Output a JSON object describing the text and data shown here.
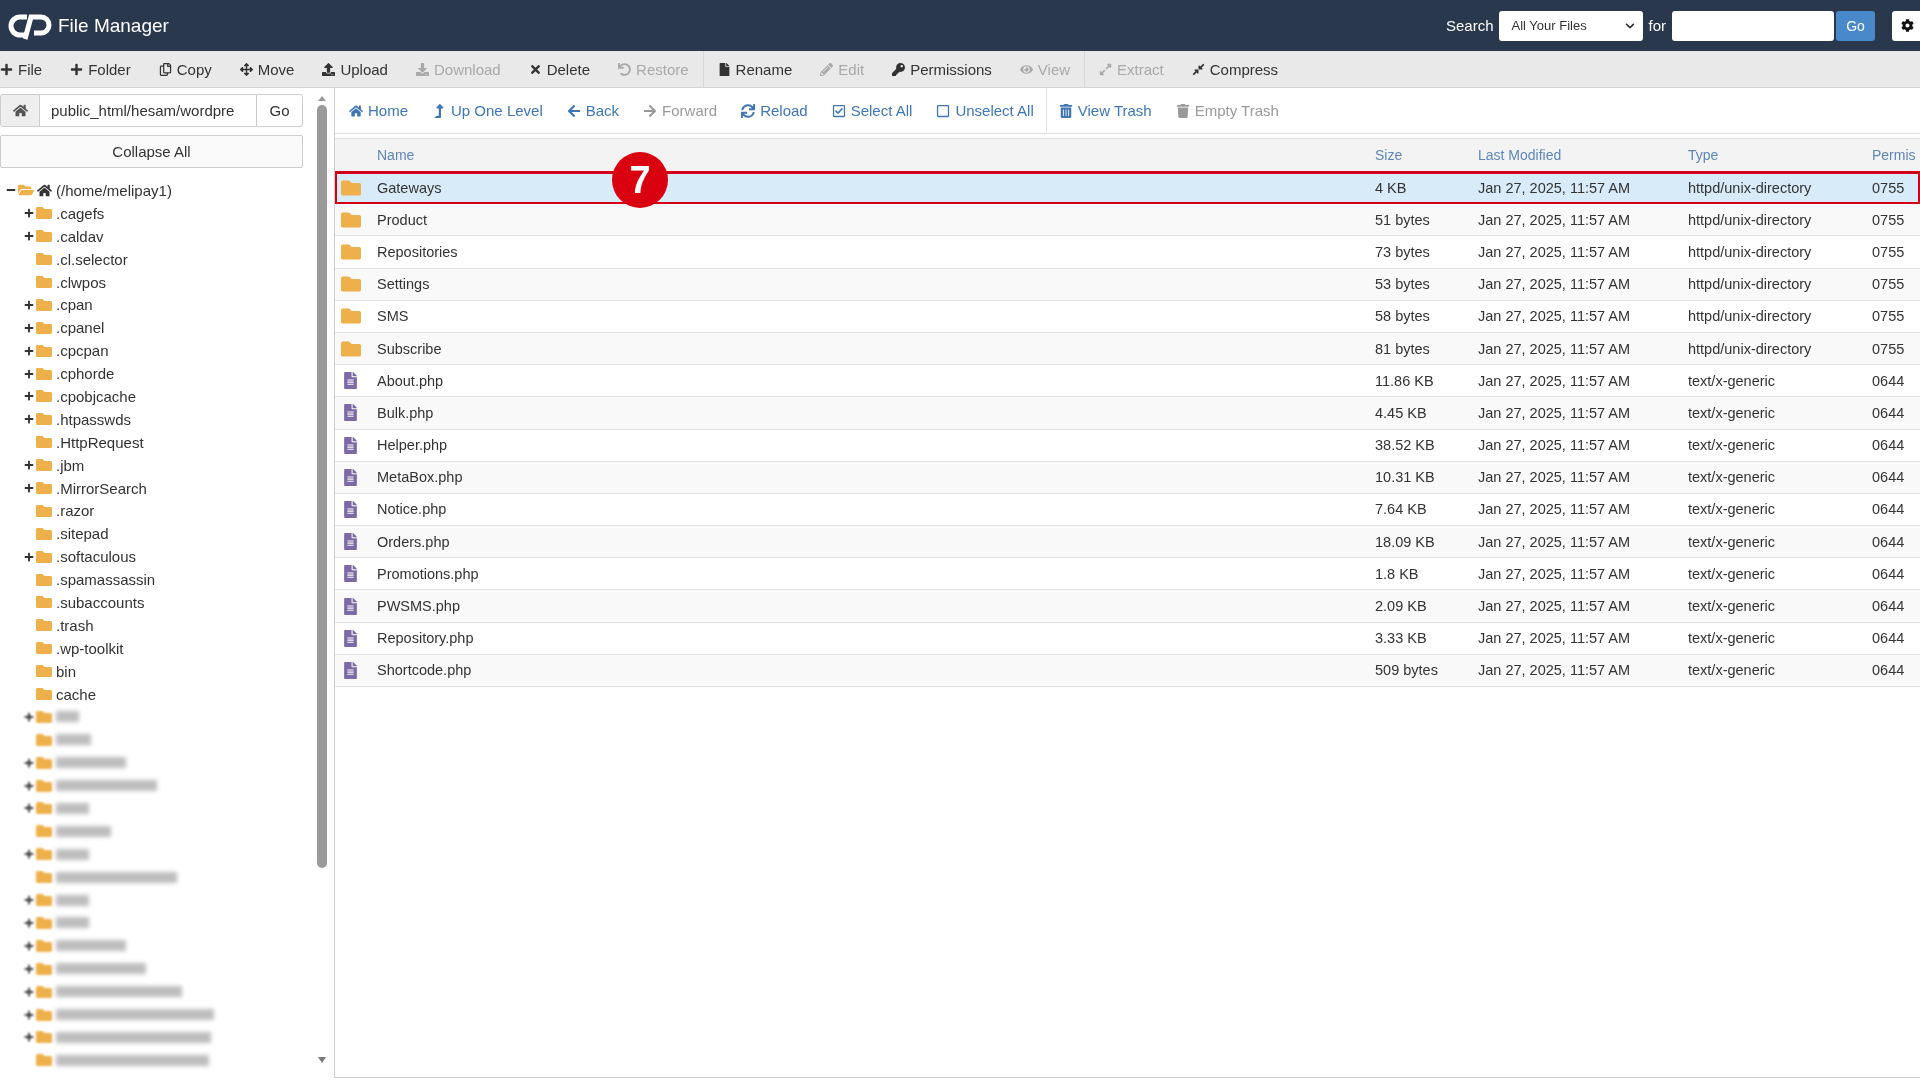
{
  "header": {
    "title": "File Manager",
    "search": {
      "label": "Search",
      "scope": "All Your Files",
      "for_label": "for",
      "button": "Go"
    }
  },
  "toolbar": [
    {
      "buttons": [
        {
          "label": "File",
          "disabled": false
        },
        {
          "label": "Folder",
          "disabled": false
        },
        {
          "label": "Copy",
          "disabled": false
        },
        {
          "label": "Move",
          "disabled": false
        },
        {
          "label": "Upload",
          "disabled": false
        },
        {
          "label": "Download",
          "disabled": true
        },
        {
          "label": "Delete",
          "disabled": false
        },
        {
          "label": "Restore",
          "disabled": true
        }
      ]
    },
    {
      "buttons": [
        {
          "label": "Rename",
          "disabled": false
        },
        {
          "label": "Edit",
          "disabled": true
        },
        {
          "label": "Permissions",
          "disabled": false
        },
        {
          "label": "View",
          "disabled": true
        }
      ]
    },
    {
      "buttons": [
        {
          "label": "Extract",
          "disabled": true
        },
        {
          "label": "Compress",
          "disabled": false
        }
      ]
    }
  ],
  "sidebar": {
    "path": {
      "value": "public_html/hesam/wordpre",
      "button": "Go"
    },
    "collapse_button": "Collapse All",
    "tree": {
      "kind": "folder",
      "label": "(/home/melipay1)",
      "expanded": true,
      "children": [
        {
          "kind": "folder",
          "label": ".cagefs",
          "expanded": false
        },
        {
          "kind": "folder",
          "label": ".caldav",
          "expanded": false
        },
        {
          "kind": "folder",
          "label": ".cl.selector"
        },
        {
          "kind": "folder",
          "label": ".clwpos"
        },
        {
          "kind": "folder",
          "label": ".cpan",
          "expanded": false
        },
        {
          "kind": "folder",
          "label": ".cpanel",
          "expanded": false
        },
        {
          "kind": "folder",
          "label": ".cpcpan",
          "expanded": false
        },
        {
          "kind": "folder",
          "label": ".cphorde",
          "expanded": false
        },
        {
          "kind": "folder",
          "label": ".cpobjcache",
          "expanded": false
        },
        {
          "kind": "folder",
          "label": ".htpasswds",
          "expanded": false
        },
        {
          "kind": "folder",
          "label": ".HttpRequest"
        },
        {
          "kind": "folder",
          "label": ".jbm",
          "expanded": false
        },
        {
          "kind": "folder",
          "label": ".MirrorSearch",
          "expanded": false
        },
        {
          "kind": "folder",
          "label": ".razor"
        },
        {
          "kind": "folder",
          "label": ".sitepad"
        },
        {
          "kind": "folder",
          "label": ".softaculous",
          "expanded": false
        },
        {
          "kind": "folder",
          "label": ".spamassassin"
        },
        {
          "kind": "folder",
          "label": ".subaccounts"
        },
        {
          "kind": "folder",
          "label": ".trash"
        },
        {
          "kind": "folder",
          "label": ".wp-toolkit"
        },
        {
          "kind": "folder",
          "label": "bin"
        },
        {
          "kind": "folder",
          "label": "cache"
        },
        {
          "kind": "blurred",
          "expanded": false
        },
        {
          "kind": "blurred"
        },
        {
          "kind": "blurred",
          "expanded": false
        },
        {
          "kind": "blurred",
          "expanded": false
        },
        {
          "kind": "blurred",
          "expanded": false
        },
        {
          "kind": "blurred"
        },
        {
          "kind": "blurred",
          "expanded": false
        },
        {
          "kind": "blurred"
        },
        {
          "kind": "blurred",
          "expanded": false
        },
        {
          "kind": "blurred",
          "expanded": false
        },
        {
          "kind": "blurred",
          "expanded": false
        },
        {
          "kind": "blurred",
          "expanded": false
        },
        {
          "kind": "blurred",
          "expanded": false
        },
        {
          "kind": "blurred",
          "expanded": false
        },
        {
          "kind": "blurred",
          "expanded": false
        },
        {
          "kind": "blurred"
        }
      ]
    }
  },
  "navigation": [
    {
      "buttons": [
        {
          "label": "Home",
          "disabled": false
        },
        {
          "label": "Up One Level",
          "disabled": false
        },
        {
          "label": "Back",
          "disabled": false
        },
        {
          "label": "Forward",
          "disabled": true
        },
        {
          "label": "Reload",
          "disabled": false
        },
        {
          "label": "Select All",
          "disabled": false
        },
        {
          "label": "Unselect All",
          "disabled": false
        }
      ]
    },
    {
      "buttons": [
        {
          "label": "View Trash",
          "disabled": false
        },
        {
          "label": "Empty Trash",
          "disabled": true
        }
      ]
    }
  ],
  "table": {
    "columns": [
      "Name",
      "Size",
      "Last Modified",
      "Type",
      "Permis"
    ],
    "rows": [
      {
        "kind": "folder",
        "selected": true,
        "annotation": "7",
        "cells": [
          "Gateways",
          "4 KB",
          "Jan 27, 2025, 11:57 AM",
          "httpd/unix-directory",
          "0755"
        ]
      },
      {
        "kind": "folder",
        "selected": false,
        "cells": [
          "Product",
          "51 bytes",
          "Jan 27, 2025, 11:57 AM",
          "httpd/unix-directory",
          "0755"
        ]
      },
      {
        "kind": "folder",
        "selected": false,
        "cells": [
          "Repositories",
          "73 bytes",
          "Jan 27, 2025, 11:57 AM",
          "httpd/unix-directory",
          "0755"
        ]
      },
      {
        "kind": "folder",
        "selected": false,
        "cells": [
          "Settings",
          "53 bytes",
          "Jan 27, 2025, 11:57 AM",
          "httpd/unix-directory",
          "0755"
        ]
      },
      {
        "kind": "folder",
        "selected": false,
        "cells": [
          "SMS",
          "58 bytes",
          "Jan 27, 2025, 11:57 AM",
          "httpd/unix-directory",
          "0755"
        ]
      },
      {
        "kind": "folder",
        "selected": false,
        "cells": [
          "Subscribe",
          "81 bytes",
          "Jan 27, 2025, 11:57 AM",
          "httpd/unix-directory",
          "0755"
        ]
      },
      {
        "kind": "file",
        "selected": false,
        "cells": [
          "About.php",
          "11.86 KB",
          "Jan 27, 2025, 11:57 AM",
          "text/x-generic",
          "0644"
        ]
      },
      {
        "kind": "file",
        "selected": false,
        "cells": [
          "Bulk.php",
          "4.45 KB",
          "Jan 27, 2025, 11:57 AM",
          "text/x-generic",
          "0644"
        ]
      },
      {
        "kind": "file",
        "selected": false,
        "cells": [
          "Helper.php",
          "38.52 KB",
          "Jan 27, 2025, 11:57 AM",
          "text/x-generic",
          "0644"
        ]
      },
      {
        "kind": "file",
        "selected": false,
        "cells": [
          "MetaBox.php",
          "10.31 KB",
          "Jan 27, 2025, 11:57 AM",
          "text/x-generic",
          "0644"
        ]
      },
      {
        "kind": "file",
        "selected": false,
        "cells": [
          "Notice.php",
          "7.64 KB",
          "Jan 27, 2025, 11:57 AM",
          "text/x-generic",
          "0644"
        ]
      },
      {
        "kind": "file",
        "selected": false,
        "cells": [
          "Orders.php",
          "18.09 KB",
          "Jan 27, 2025, 11:57 AM",
          "text/x-generic",
          "0644"
        ]
      },
      {
        "kind": "file",
        "selected": false,
        "cells": [
          "Promotions.php",
          "1.8 KB",
          "Jan 27, 2025, 11:57 AM",
          "text/x-generic",
          "0644"
        ]
      },
      {
        "kind": "file",
        "selected": false,
        "cells": [
          "PWSMS.php",
          "2.09 KB",
          "Jan 27, 2025, 11:57 AM",
          "text/x-generic",
          "0644"
        ]
      },
      {
        "kind": "file",
        "selected": false,
        "cells": [
          "Repository.php",
          "3.33 KB",
          "Jan 27, 2025, 11:57 AM",
          "text/x-generic",
          "0644"
        ]
      },
      {
        "kind": "file",
        "selected": false,
        "cells": [
          "Shortcode.php",
          "509 bytes",
          "Jan 27, 2025, 11:57 AM",
          "text/x-generic",
          "0644"
        ]
      }
    ]
  }
}
